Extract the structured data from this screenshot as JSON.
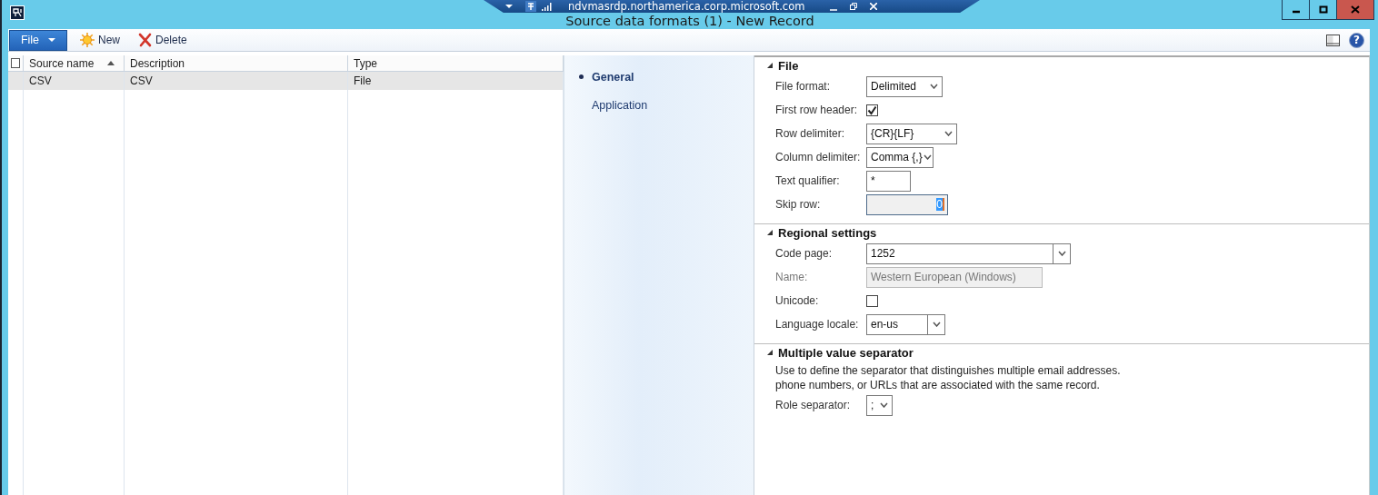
{
  "remote_bar": {
    "host": "ndvmasrdp.northamerica.corp.microsoft.com"
  },
  "window": {
    "title": "Source data formats (1) - New Record"
  },
  "toolbar": {
    "file_menu": "File",
    "help_glyph": "?",
    "buttons": [
      {
        "label": "New",
        "kind": "new"
      },
      {
        "label": "Delete",
        "kind": "delete"
      }
    ]
  },
  "grid": {
    "select_all_checked": false,
    "columns": [
      {
        "label": "Source name",
        "sorted": true
      },
      {
        "label": "Description",
        "sorted": false
      },
      {
        "label": "Type",
        "sorted": false
      }
    ],
    "rows": [
      {
        "cells": [
          "CSV",
          "CSV",
          "File"
        ],
        "selected": true
      }
    ]
  },
  "nav": [
    {
      "label": "General",
      "selected": true
    },
    {
      "label": "Application",
      "selected": false
    }
  ],
  "sections": [
    {
      "title": "File",
      "expanded": true,
      "fields": [
        {
          "kind": "dropdown",
          "label": "File format:",
          "value": "Delimited"
        },
        {
          "kind": "checkbox",
          "label": "First row header:",
          "checked": true
        },
        {
          "kind": "dropdown",
          "label": "Row delimiter:",
          "value": "{CR}{LF}"
        },
        {
          "kind": "dropdown",
          "label": "Column delimiter:",
          "value": "Comma {,}"
        },
        {
          "kind": "text",
          "label": "Text qualifier:",
          "value": "*"
        },
        {
          "kind": "number",
          "label": "Skip row:",
          "value": "0",
          "disabled": false
        }
      ]
    },
    {
      "title": "Regional settings",
      "expanded": true,
      "fields": [
        {
          "kind": "combo",
          "label": "Code page:",
          "value": "1252"
        },
        {
          "kind": "text",
          "label": "Name:",
          "value": "Western European (Windows)",
          "disabled": true
        },
        {
          "kind": "checkbox",
          "label": "Unicode:",
          "checked": false
        },
        {
          "kind": "combo",
          "label": "Language locale:",
          "value": "en-us"
        }
      ]
    },
    {
      "title": "Multiple value separator",
      "expanded": true,
      "description": "Use to define the separator that distinguishes multiple email addresses. phone numbers, or URLs that are associated with the same record.",
      "fields": [
        {
          "kind": "dropdown",
          "label": "Role separator:",
          "value": ";"
        }
      ]
    }
  ]
}
